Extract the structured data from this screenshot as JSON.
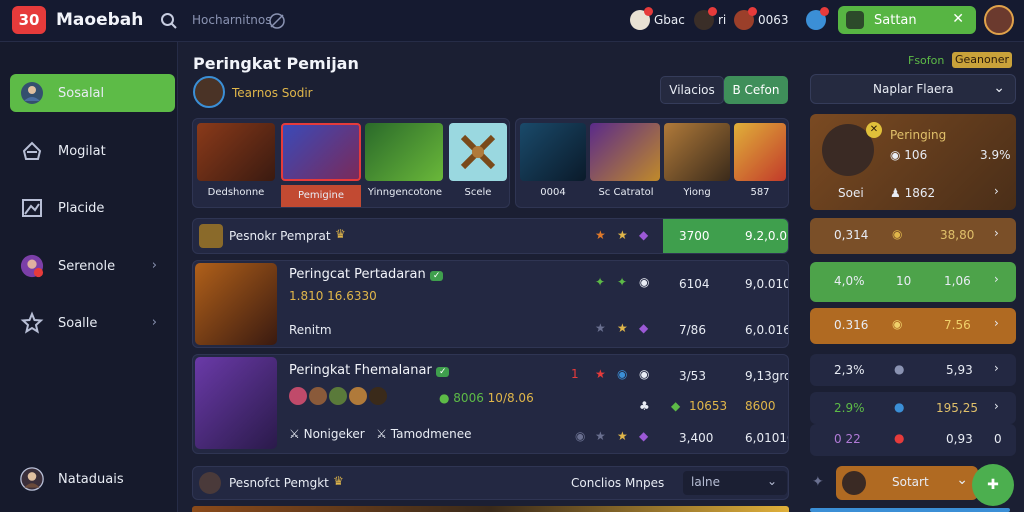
{
  "app": {
    "logo": "30",
    "name": "Maoebah"
  },
  "topbar": {
    "search_placeholder": "Hocharnitnos",
    "items": [
      {
        "label": "Gbac"
      },
      {
        "label": "ri"
      },
      {
        "label": "0063"
      }
    ],
    "user_label": "Sattan"
  },
  "sidebar": {
    "items": [
      {
        "label": "Sosalal"
      },
      {
        "label": "Mogilat"
      },
      {
        "label": "Placide"
      },
      {
        "label": "Serenole"
      },
      {
        "label": "Soalle"
      }
    ],
    "footer_label": "Nataduais"
  },
  "main": {
    "title": "Peringkat Pemijan",
    "subtitle": "Tearnos Sodir",
    "btn_dark": "Vilacios",
    "btn_green": "B Cefon",
    "hero_group1": [
      "Dedshonne",
      "Pemigine",
      "Yinngencotone",
      "Scele"
    ],
    "hero_group2": [
      "0004",
      "Sc Catratol",
      "Yiong",
      "587"
    ],
    "summary": {
      "label": "Pesnokr Pemprat",
      "v1": "3700",
      "v2": "9.2,0.0"
    },
    "entry1": {
      "title": "Peringcat Pertadaran",
      "stats": "1.810  16.6330",
      "sub": "Renitm",
      "r1v1": "6104",
      "r1v2": "9,0.010",
      "r2v1": "7/86",
      "r2v2": "6,0.016"
    },
    "entry2": {
      "title": "Peringkat Fhemalanar",
      "stats_a": "8006",
      "stats_b": "10/8.06",
      "tag1": "Nonigeker",
      "tag2": "Tamodmenee",
      "r1v1": "3/53",
      "r1v2": "9,13grd",
      "r2v1": "10653",
      "r2v2": "8600",
      "r3v1": "3,400",
      "r3v2": "6,010100"
    },
    "footer_row": {
      "label": "Pesnofct Pemgkt",
      "center": "Conclios Mnpes",
      "select": "lalne"
    }
  },
  "right": {
    "badge_a": "Fsofon",
    "badge_b": "Geanoner",
    "dropdown": "Naplar Flaera",
    "card": {
      "title": "Peringing",
      "v1": "106",
      "v2": "3.9%",
      "name": "Soei",
      "v3": "1862"
    },
    "rows": [
      {
        "a": "0,314",
        "b": "38,80",
        "color": "#7a4f28"
      },
      {
        "a": "4,0%",
        "b": "1,06",
        "mid": "10",
        "color": "#4da34a"
      },
      {
        "a": "0.316",
        "b": "7.56",
        "color": "#b06a22"
      },
      {
        "a": "2,3%",
        "b": "5,93",
        "color": "#232842"
      },
      {
        "a": "2.9%",
        "b": "195,25",
        "color": "#232842"
      },
      {
        "a": "0 22",
        "b": "0,93",
        "c": "0",
        "color": "#232842"
      }
    ],
    "footer_btn": "Sotart"
  },
  "colors": {
    "accent": "#5dbb47",
    "bg": "#1b1f33",
    "gold": "#e0b64a"
  }
}
